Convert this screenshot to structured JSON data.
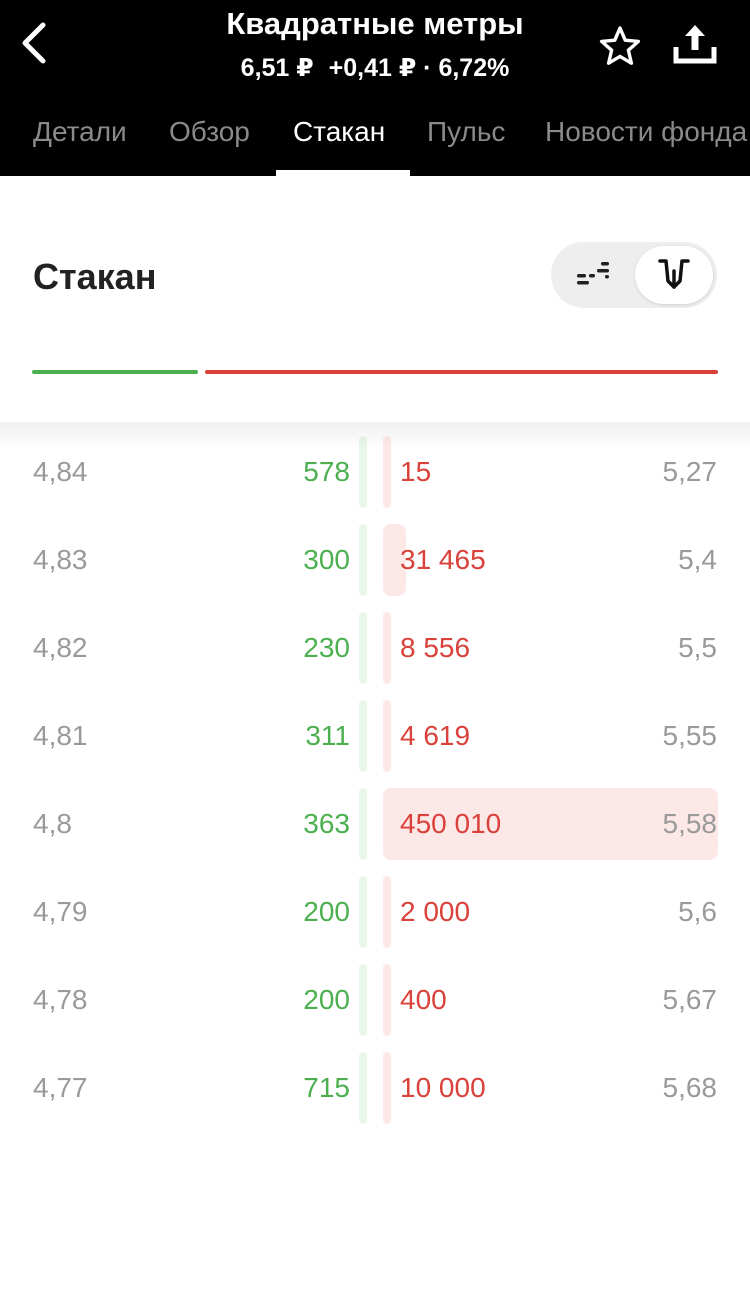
{
  "header": {
    "title": "Квадратные метры",
    "price": "6,51 ₽",
    "change": "+0,41 ₽ · 6,72%",
    "back_icon": "chevron-left-icon",
    "favorite_icon": "star-outline-icon",
    "share_icon": "share-upload-icon"
  },
  "tabs": [
    {
      "label": "Детали",
      "active": false
    },
    {
      "label": "Обзор",
      "active": false
    },
    {
      "label": "Стакан",
      "active": true
    },
    {
      "label": "Пульс",
      "active": false
    },
    {
      "label": "Новости фонда",
      "active": false
    }
  ],
  "section": {
    "title": "Стакан",
    "view_toggle": {
      "options": [
        "list-view-icon",
        "depth-chart-icon"
      ],
      "selected": "depth-chart-icon"
    },
    "ratio": {
      "bid_share": 0.24,
      "ask_share": 0.76
    }
  },
  "order_book": {
    "rows": [
      {
        "bid_price": "4,84",
        "bid_qty": "578",
        "ask_qty": "15",
        "ask_price": "5,27",
        "bid_fill": 0.01,
        "ask_fill": 0.01
      },
      {
        "bid_price": "4,83",
        "bid_qty": "300",
        "ask_qty": "31 465",
        "ask_price": "5,4",
        "bid_fill": 0.01,
        "ask_fill": 0.07
      },
      {
        "bid_price": "4,82",
        "bid_qty": "230",
        "ask_qty": "8 556",
        "ask_price": "5,5",
        "bid_fill": 0.01,
        "ask_fill": 0.01
      },
      {
        "bid_price": "4,81",
        "bid_qty": "311",
        "ask_qty": "4 619",
        "ask_price": "5,55",
        "bid_fill": 0.01,
        "ask_fill": 0.01
      },
      {
        "bid_price": "4,8",
        "bid_qty": "363",
        "ask_qty": "450 010",
        "ask_price": "5,58",
        "bid_fill": 0.01,
        "ask_fill": 1.0
      },
      {
        "bid_price": "4,79",
        "bid_qty": "200",
        "ask_qty": "2 000",
        "ask_price": "5,6",
        "bid_fill": 0.01,
        "ask_fill": 0.01
      },
      {
        "bid_price": "4,78",
        "bid_qty": "200",
        "ask_qty": "400",
        "ask_price": "5,67",
        "bid_fill": 0.01,
        "ask_fill": 0.01
      },
      {
        "bid_price": "4,77",
        "bid_qty": "715",
        "ask_qty": "10 000",
        "ask_price": "5,68",
        "bid_fill": 0.01,
        "ask_fill": 0.01
      }
    ]
  },
  "colors": {
    "bid": "#4caf50",
    "ask": "#d9413a",
    "bid_bar": "#e9f6ea",
    "ask_bar": "#fde8e8",
    "header_bg": "#000000"
  }
}
